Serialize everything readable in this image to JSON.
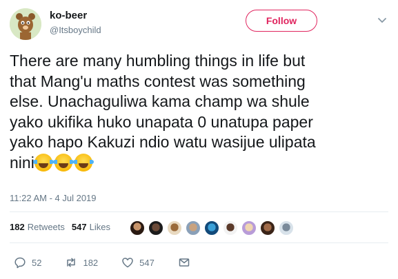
{
  "user": {
    "display_name": "ko-beer",
    "handle": "@Itsboychild"
  },
  "follow_label": "Follow",
  "tweet": {
    "text": "There are many humbling things in life but\nthat Mang'u maths contest was something\nelse. Unachaguliwa kama champ wa shule\nyako ukifika huko unapata 0 unatupa paper\nyako hapo Kakuzi ndio watu wasijue ulipata\nnini",
    "emojis": [
      "face-with-tears-of-joy",
      "face-with-tears-of-joy",
      "face-with-tears-of-joy"
    ],
    "timestamp": "11:22 AM - 4 Jul 2019"
  },
  "stats": {
    "retweets_count": "182",
    "retweets_label": "Retweets",
    "likes_count": "547",
    "likes_label": "Likes",
    "liker_avatar_count": 9
  },
  "actions": {
    "reply_count": "52",
    "retweet_count": "182",
    "like_count": "547"
  },
  "colors": {
    "follow_accent": "#e0245e",
    "muted_text": "#657786",
    "divider": "#e6ecf0"
  }
}
